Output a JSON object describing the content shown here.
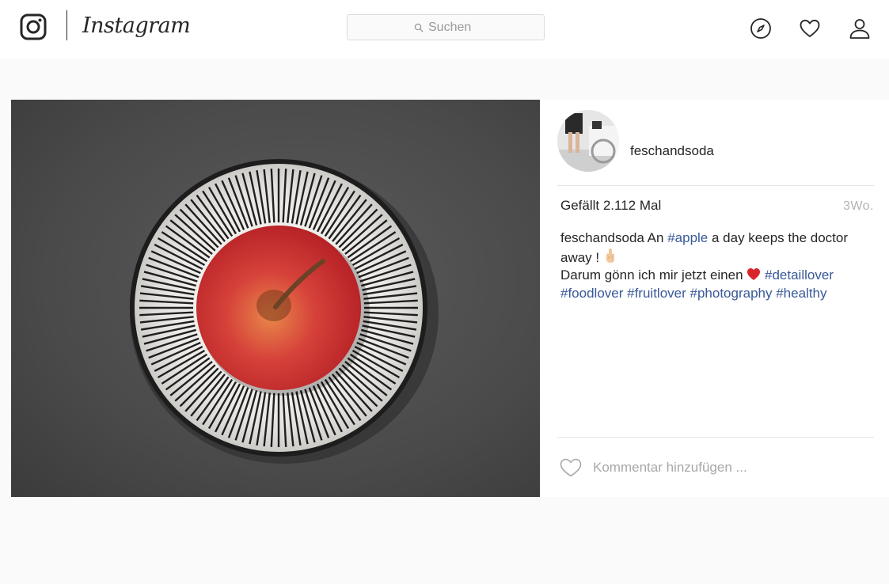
{
  "header": {
    "brand_name": "Instagram",
    "search": {
      "placeholder": "Suchen",
      "icon": "search-icon"
    },
    "nav_icons": [
      "compass-icon",
      "heart-icon",
      "profile-icon"
    ]
  },
  "post": {
    "image_alt_icon": "apple-photo",
    "user": {
      "username": "feschandsoda",
      "avatar_icon": "avatar-photo"
    },
    "likes_text": "Gefällt 2.112 Mal",
    "age": "3Wo.",
    "caption": {
      "author": "feschandsoda",
      "text_1": "An",
      "tag_apple": "#apple",
      "text_2": "a day keeps the doctor away !",
      "text_3": "Darum gönn ich mir jetzt einen",
      "tag_detaillover": "#detaillover",
      "tag_foodlover": "#foodlover",
      "tag_fruitlover": "#fruitlover",
      "tag_photography": "#photography",
      "tag_healthy": "#healthy"
    },
    "comment": {
      "placeholder": "Kommentar hinzufügen ...",
      "like_icon": "heart-outline-icon"
    }
  },
  "colors": {
    "text": "#262626",
    "hashtag": "#385898",
    "muted": "#999999",
    "background": "#fafafa",
    "border": "#dbdbdb"
  }
}
